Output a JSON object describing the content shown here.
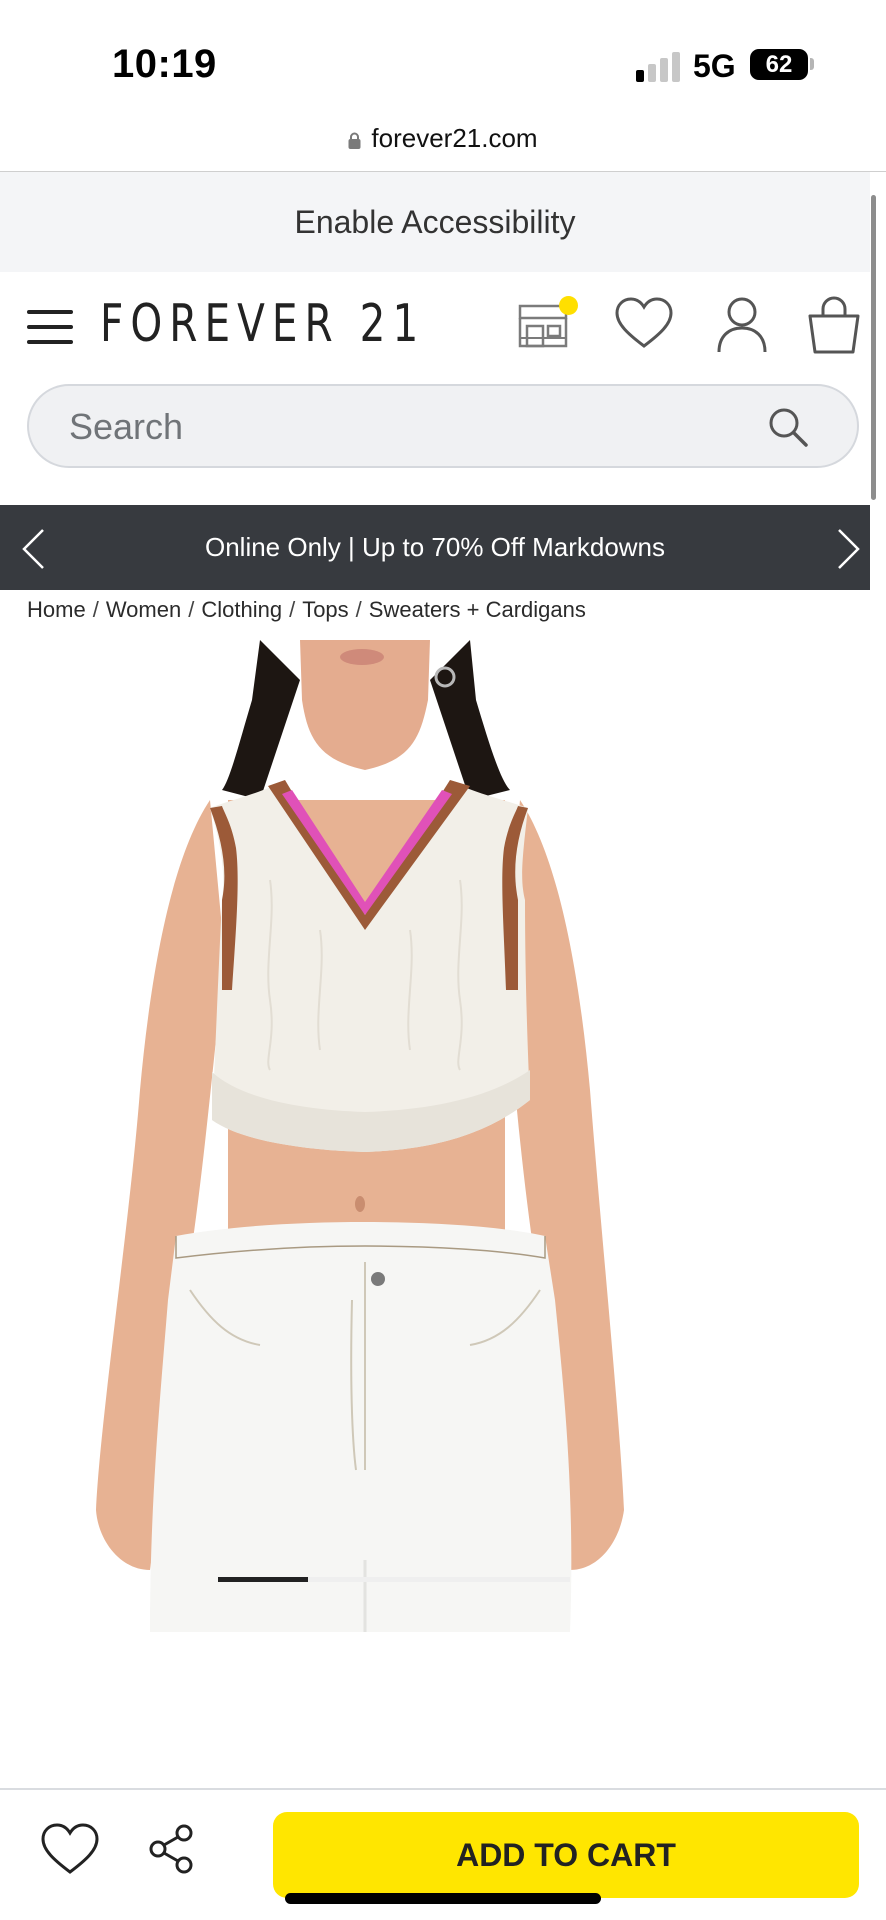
{
  "status_bar": {
    "time": "10:19",
    "network": "5G",
    "battery": "62"
  },
  "browser": {
    "url": "forever21.com"
  },
  "accessibility": {
    "label": "Enable Accessibility"
  },
  "header": {
    "logo": "FOREVER 21",
    "accent_color": "#ffdf00"
  },
  "search": {
    "placeholder": "Search"
  },
  "promo": {
    "text": "Online Only | Up to 70% Off Markdowns"
  },
  "breadcrumb": [
    {
      "label": "Home"
    },
    {
      "label": "Women"
    },
    {
      "label": "Clothing"
    },
    {
      "label": "Tops"
    },
    {
      "label": "Sweaters + Cardigans"
    }
  ],
  "breadcrumb_separator": "/",
  "carousel": {
    "current": 1,
    "total": 4
  },
  "bottom_bar": {
    "add_to_cart": "ADD TO CART",
    "button_color": "#ffe600"
  },
  "icons": [
    "lock-icon",
    "menu-icon",
    "store-icon",
    "heart-icon",
    "user-icon",
    "bag-icon",
    "search-icon",
    "chevron-left-icon",
    "chevron-right-icon",
    "share-icon"
  ]
}
